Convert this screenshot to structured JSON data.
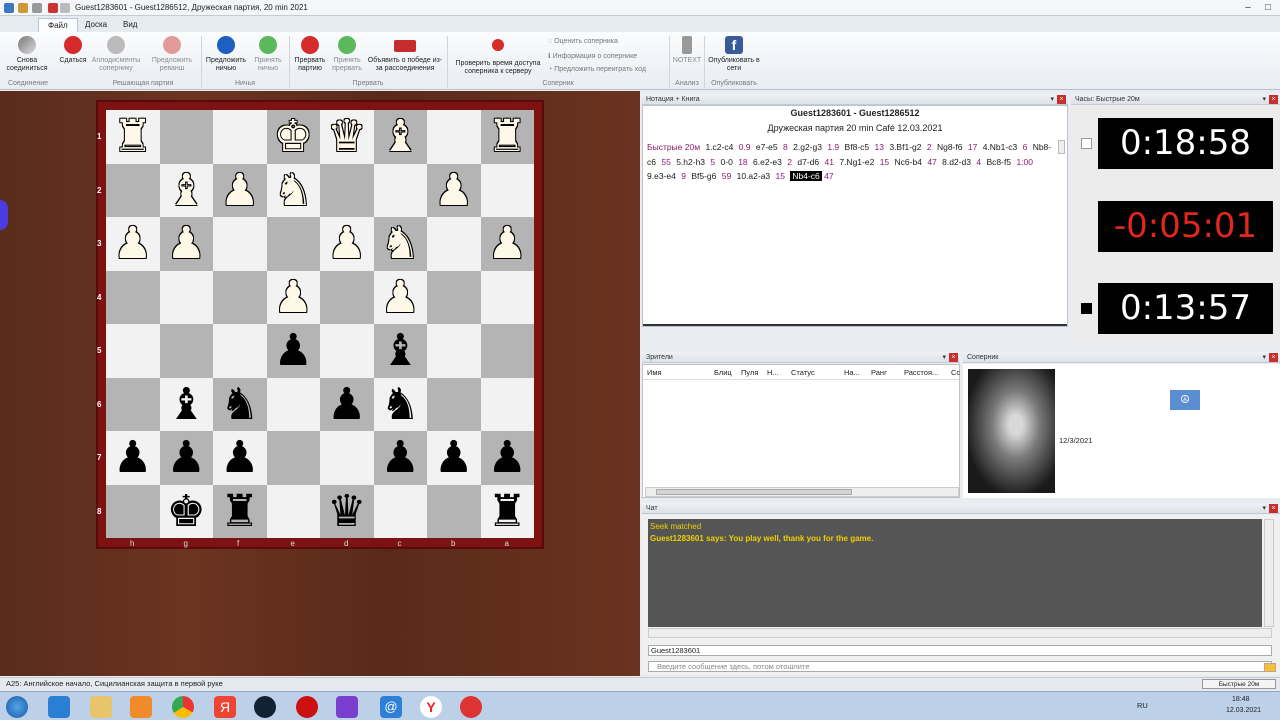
{
  "window": {
    "title": "Guest1283601 - Guest1286512, Дружеская партия, 20 min 2021"
  },
  "menu_tabs": [
    "Файл",
    "Доска",
    "Вид"
  ],
  "ribbon": {
    "buttons": [
      {
        "label": "Снова соединиться",
        "icon": "reconnect-icon"
      },
      {
        "label": "Сдаться",
        "icon": "resign-icon"
      },
      {
        "label": "Аплодисменты сопернику",
        "icon": "applause-icon"
      },
      {
        "label": "Предложить реванш",
        "icon": "rematch-icon"
      },
      {
        "label": "Предложить ничью",
        "icon": "offer-draw-icon"
      },
      {
        "label": "Принять ничью",
        "icon": "accept-draw-icon"
      },
      {
        "label": "Прервать партию",
        "icon": "abort-icon"
      },
      {
        "label": "Принять прервать",
        "icon": "accept-abort-icon"
      },
      {
        "label": "Объявить о победе из-за рассоединения",
        "icon": "claim-win-icon"
      },
      {
        "label": "Проверить время доступа соперника к серверу",
        "icon": "ping-icon"
      },
      {
        "label": "NOTEXT",
        "icon": "analysis-icon"
      },
      {
        "label": "Опубликовать в сети",
        "icon": "facebook-icon"
      }
    ],
    "small_items": [
      "Оценить соперника",
      "Информация о сопернике",
      "Предложить переиграть ход"
    ],
    "groups": [
      "Соединение",
      "Решающая партия",
      "Ничья",
      "Прервать",
      "Соперник",
      "Анализ",
      "Опубликовать"
    ]
  },
  "board": {
    "ranks": [
      "1",
      "2",
      "3",
      "4",
      "5",
      "6",
      "7",
      "8"
    ],
    "files": [
      "h",
      "g",
      "f",
      "e",
      "d",
      "c",
      "b",
      "a"
    ],
    "pieces": [
      {
        "piece": "♜",
        "color": "w",
        "rank": 0,
        "file": 0
      },
      {
        "piece": "♚",
        "color": "w",
        "rank": 0,
        "file": 3
      },
      {
        "piece": "♛",
        "color": "w",
        "rank": 0,
        "file": 4
      },
      {
        "piece": "♝",
        "color": "w",
        "rank": 0,
        "file": 5
      },
      {
        "piece": "♜",
        "color": "w",
        "rank": 0,
        "file": 7
      },
      {
        "piece": "♝",
        "color": "w",
        "rank": 1,
        "file": 1
      },
      {
        "piece": "♟",
        "color": "w",
        "rank": 1,
        "file": 2
      },
      {
        "piece": "♞",
        "color": "w",
        "rank": 1,
        "file": 3
      },
      {
        "piece": "♟",
        "color": "w",
        "rank": 1,
        "file": 6
      },
      {
        "piece": "♟",
        "color": "w",
        "rank": 2,
        "file": 0
      },
      {
        "piece": "♟",
        "color": "w",
        "rank": 2,
        "file": 1
      },
      {
        "piece": "♟",
        "color": "w",
        "rank": 2,
        "file": 4
      },
      {
        "piece": "♞",
        "color": "w",
        "rank": 2,
        "file": 5
      },
      {
        "piece": "♟",
        "color": "w",
        "rank": 2,
        "file": 7
      },
      {
        "piece": "♟",
        "color": "w",
        "rank": 3,
        "file": 3
      },
      {
        "piece": "♟",
        "color": "w",
        "rank": 3,
        "file": 5
      },
      {
        "piece": "♟",
        "color": "b",
        "rank": 4,
        "file": 3
      },
      {
        "piece": "♝",
        "color": "b",
        "rank": 4,
        "file": 5
      },
      {
        "piece": "♝",
        "color": "b",
        "rank": 5,
        "file": 1
      },
      {
        "piece": "♞",
        "color": "b",
        "rank": 5,
        "file": 2
      },
      {
        "piece": "♟",
        "color": "b",
        "rank": 5,
        "file": 4
      },
      {
        "piece": "♞",
        "color": "b",
        "rank": 5,
        "file": 5
      },
      {
        "piece": "♟",
        "color": "b",
        "rank": 6,
        "file": 0
      },
      {
        "piece": "♟",
        "color": "b",
        "rank": 6,
        "file": 1
      },
      {
        "piece": "♟",
        "color": "b",
        "rank": 6,
        "file": 2
      },
      {
        "piece": "♟",
        "color": "b",
        "rank": 6,
        "file": 5
      },
      {
        "piece": "♟",
        "color": "b",
        "rank": 6,
        "file": 6
      },
      {
        "piece": "♟",
        "color": "b",
        "rank": 6,
        "file": 7
      },
      {
        "piece": "♚",
        "color": "b",
        "rank": 7,
        "file": 1
      },
      {
        "piece": "♜",
        "color": "b",
        "rank": 7,
        "file": 2
      },
      {
        "piece": "♛",
        "color": "b",
        "rank": 7,
        "file": 4
      },
      {
        "piece": "♜",
        "color": "b",
        "rank": 7,
        "file": 7
      }
    ]
  },
  "notation": {
    "header": "Нотация + Книга",
    "players": "Guest1283601 - Guest1286512",
    "event": "Дружеская партия 20 min Café 12.03.2021",
    "moves": [
      {
        "t": "Быстрые 20м",
        "c": "tm"
      },
      {
        "t": "1.c2-c4",
        "c": "mv"
      },
      {
        "t": "0.9",
        "c": "tm"
      },
      {
        "t": "e7-e5",
        "c": "mv"
      },
      {
        "t": "8",
        "c": "tm"
      },
      {
        "t": "2.g2-g3",
        "c": "mv"
      },
      {
        "t": "1.9",
        "c": "tm"
      },
      {
        "t": "Bf8-c5",
        "c": "mv"
      },
      {
        "t": "13",
        "c": "tm"
      },
      {
        "t": "3.Bf1-g2",
        "c": "mv"
      },
      {
        "t": "2",
        "c": "tm"
      },
      {
        "t": "Ng8-f6",
        "c": "mv"
      },
      {
        "t": "17",
        "c": "tm"
      },
      {
        "t": "4.Nb1-c3",
        "c": "mv"
      },
      {
        "t": "6",
        "c": "tm"
      },
      {
        "t": "Nb8-c6",
        "c": "mv"
      },
      {
        "t": "55",
        "c": "tm"
      },
      {
        "t": "5.h2-h3",
        "c": "mv"
      },
      {
        "t": "5",
        "c": "tm"
      },
      {
        "t": "0-0",
        "c": "mv"
      },
      {
        "t": "18",
        "c": "tm"
      },
      {
        "t": "6.e2-e3",
        "c": "mv"
      },
      {
        "t": "2",
        "c": "tm"
      },
      {
        "t": "d7-d6",
        "c": "mv"
      },
      {
        "t": "41",
        "c": "tm"
      },
      {
        "t": "7.Ng1-e2",
        "c": "mv"
      },
      {
        "t": "15",
        "c": "tm"
      },
      {
        "t": "Nc6-b4",
        "c": "mv"
      },
      {
        "t": "47",
        "c": "tm"
      },
      {
        "t": "8.d2-d3",
        "c": "mv"
      },
      {
        "t": "4",
        "c": "tm"
      },
      {
        "t": "Bc8-f5",
        "c": "mv"
      },
      {
        "t": "1:00",
        "c": "tm"
      },
      {
        "t": "9.e3-e4",
        "c": "mv"
      },
      {
        "t": "9",
        "c": "tm"
      },
      {
        "t": "Bf5-g6",
        "c": "mv"
      },
      {
        "t": "59",
        "c": "tm"
      },
      {
        "t": "10.a2-a3",
        "c": "mv"
      },
      {
        "t": "15",
        "c": "tm"
      },
      {
        "t": "Nb4-c6",
        "c": "sel"
      },
      {
        "t": "47",
        "c": "tm"
      }
    ]
  },
  "clocks": {
    "header": "Часы: Быстрые 20м",
    "top": "0:18:58",
    "middle": "-0:05:01",
    "bottom": "0:13:57"
  },
  "spectators": {
    "header": "Зрители",
    "columns": [
      "Имя",
      "Блиц",
      "Пуля",
      "Н...",
      "Статус",
      "На...",
      "Ранг",
      "Расстоя...",
      "Сс"
    ]
  },
  "opponent": {
    "header": "Соперник",
    "date": "12/3/2021"
  },
  "chat": {
    "header": "Чат",
    "lines": [
      "Seek matched",
      "Guest1283601 says: You play well, thank you for the game."
    ],
    "user": "Guest1283601",
    "placeholder": "Введите сообщение здесь, потом отошлите"
  },
  "status": {
    "opening": "A25: Английское начало, Сицилианская защита в первой руке",
    "mode": "Быстрые 20м"
  },
  "taskbar": {
    "lang": "RU",
    "time": "18:48",
    "date": "12.03.2021"
  }
}
